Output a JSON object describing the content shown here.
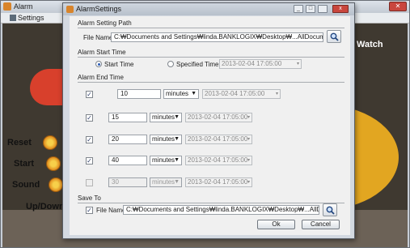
{
  "background": {
    "title": "Alarm",
    "menu": {
      "settings": "Settings"
    },
    "labels": {
      "watch": "Watch",
      "reset": "Reset",
      "start": "Start",
      "sound": "Sound",
      "updown": "Up/Down"
    }
  },
  "dialog": {
    "title": "AlarmSettings",
    "title_buttons": {
      "minimize": "_",
      "maximize": "□",
      "close": "x"
    },
    "sound_path": {
      "section": "Alarm Setting Path",
      "label": "File Name",
      "value": "C:₩Documents and Settings₩linda.BANKLOGIX₩Desktop₩...AllDocument₩Techn"
    },
    "start_time": {
      "section": "Alarm Start Time",
      "option_start": "Start Time",
      "option_specified": "Specified Time",
      "selected": "Start Time",
      "specified_value": "2013-02-04 17:05:00"
    },
    "end_time": {
      "section": "Alarm End Time",
      "rows": [
        {
          "checked": true,
          "enabled": true,
          "value": "10",
          "unit": "minutes",
          "time": "2013-02-04 17:05:00"
        },
        {
          "checked": true,
          "enabled": true,
          "value": "15",
          "unit": "minutes",
          "time": "2013-02-04 17:05:00"
        },
        {
          "checked": true,
          "enabled": true,
          "value": "20",
          "unit": "minutes",
          "time": "2013-02-04 17:05:00"
        },
        {
          "checked": true,
          "enabled": true,
          "value": "40",
          "unit": "minutes",
          "time": "2013-02-04 17:05:00"
        },
        {
          "checked": false,
          "enabled": false,
          "value": "30",
          "unit": "minutes",
          "time": "2013-02-04 17:05:00"
        }
      ]
    },
    "save_to": {
      "section": "Save To",
      "checked": true,
      "label": "File Name",
      "value": "C:₩Documents and Settings₩linda.BANKLOGIX₩Desktop₩...AllDocument₩1"
    },
    "buttons": {
      "ok": "Ok",
      "cancel": "Cancel"
    }
  },
  "colors": {
    "accent": "#2a5bb5",
    "dialog_bg": "#f0f0f0",
    "titlebar": "#c3cad3"
  },
  "icons": {
    "browse": "magnifier-icon",
    "calendar": "calendar-icon"
  }
}
